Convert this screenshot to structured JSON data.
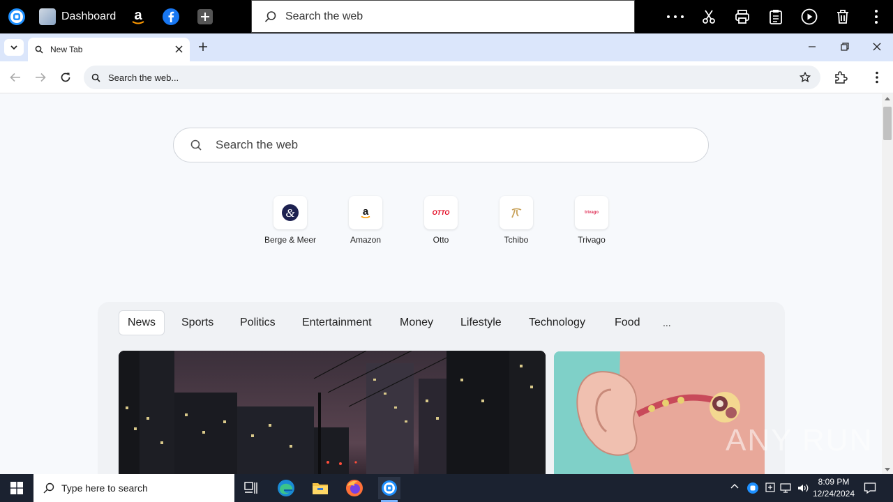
{
  "topbar": {
    "dashboard_label": "Dashboard",
    "search_placeholder": "Search the web"
  },
  "tabstrip": {
    "tab_title": "New Tab"
  },
  "toolbar": {
    "omnibox_placeholder": "Search the web..."
  },
  "page": {
    "search_placeholder": "Search the web",
    "shortcuts": [
      {
        "label": "Berge & Meer",
        "icon": "berge-meer-icon"
      },
      {
        "label": "Amazon",
        "icon": "amazon-icon"
      },
      {
        "label": "Otto",
        "icon": "otto-icon"
      },
      {
        "label": "Tchibo",
        "icon": "tchibo-icon"
      },
      {
        "label": "Trivago",
        "icon": "trivago-icon"
      }
    ],
    "tabs": [
      "News",
      "Sports",
      "Politics",
      "Entertainment",
      "Money",
      "Lifestyle",
      "Technology",
      "Food",
      "..."
    ],
    "active_tab": "News",
    "shortcut_logo_text": {
      "amazon": "a",
      "otto": "OTTO",
      "trivago": "trivago"
    }
  },
  "watermark": "ANY RUN",
  "taskbar": {
    "search_placeholder": "Type here to search",
    "time": "8:09 PM",
    "date": "12/24/2024"
  },
  "colors": {
    "topbar_bg": "#000000",
    "tabstrip_bg": "#dbe6fb",
    "taskbar_bg": "#1b2230",
    "otto_red": "#e2001a"
  }
}
